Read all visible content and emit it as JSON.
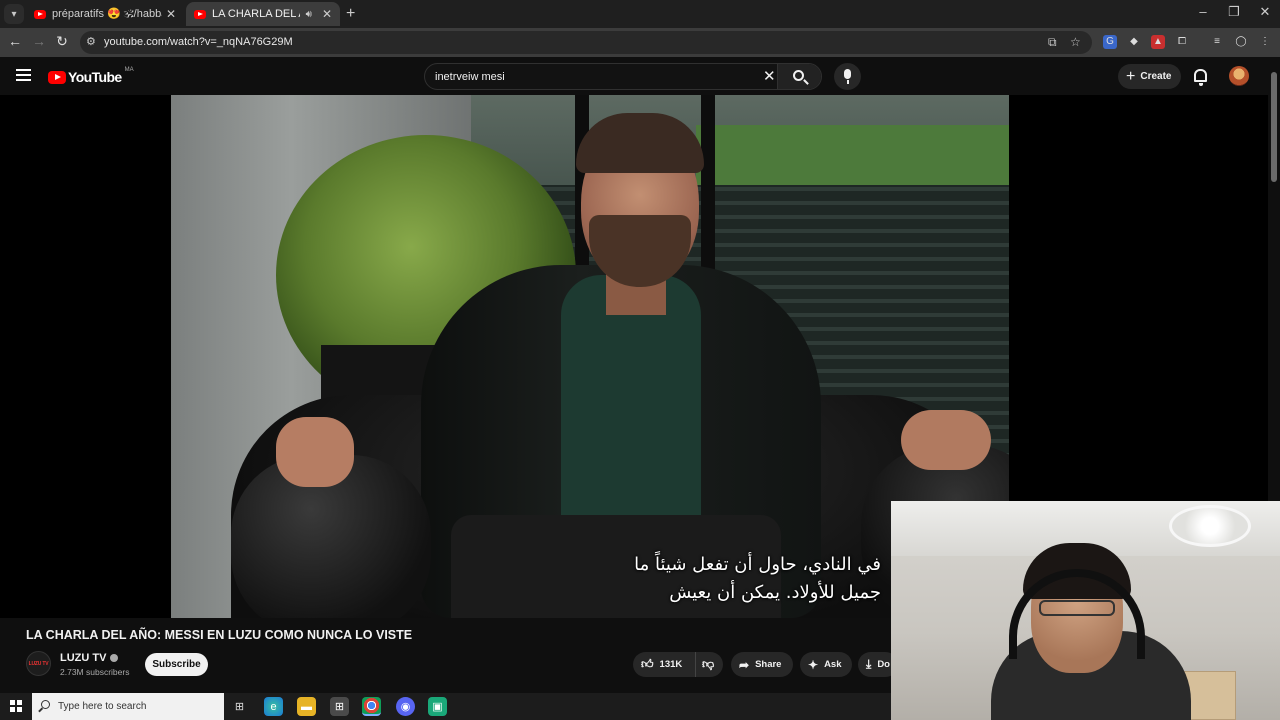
{
  "browser": {
    "tabs": [
      {
        "title": "préparatifs 😍 🕉/habbat abdel",
        "active": false
      },
      {
        "title": "LA CHARLA DEL AÑO: MES",
        "active": true
      }
    ],
    "url": "youtube.com/watch?v=_nqNA76G29M"
  },
  "youtube": {
    "logo_text": "YouTube",
    "region": "MA",
    "search_value": "inetrveiw mesi",
    "create_label": "Create"
  },
  "video": {
    "subtitle_line1": "في النادي، حاول أن تفعل شيئاً ما",
    "subtitle_line2": "جميل للأولاد. يمكن أن يعيش",
    "title": "LA CHARLA DEL AÑO: MESSI EN LUZU COMO NUNCA LO VISTE",
    "channel_name": "LUZU TV",
    "channel_avatar_text": "LUZU TV",
    "subscribers": "2.73M subscribers",
    "subscribe_label": "Subscribe",
    "likes": "131K",
    "share_label": "Share",
    "ask_label": "Ask",
    "download_label": "Do"
  },
  "taskbar": {
    "search_placeholder": "Type here to search"
  },
  "icons": {
    "accent_red": "#ff0000",
    "tab_favicon": "youtube-icon",
    "taskbar_apps": [
      "task-view-icon",
      "edge-icon",
      "file-explorer-icon",
      "store-icon",
      "chrome-icon",
      "discord-icon",
      "app-icon"
    ]
  }
}
